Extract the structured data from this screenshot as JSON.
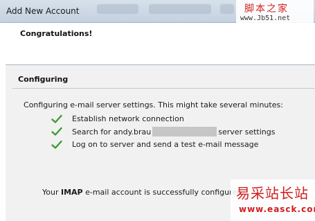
{
  "window": {
    "title": "Add New Account"
  },
  "header": {
    "heading": "Congratulations!"
  },
  "section": {
    "title": "Configuring",
    "lead": "Configuring e-mail server settings. This might take several minutes:",
    "steps": [
      {
        "label": "Establish network connection"
      },
      {
        "label_prefix": "Search for andy.brau",
        "label_suffix": "server settings"
      },
      {
        "label": "Log on to server and send a test e-mail message"
      }
    ]
  },
  "result": {
    "prefix": "Your ",
    "protocol": "IMAP",
    "suffix": " e-mail account is successfully configured."
  },
  "watermarks": {
    "top_text": "脚本之家",
    "top_url": "www.Jb51.net",
    "bottom_text": "易采站长站",
    "bottom_url": "www.easck.com"
  },
  "colors": {
    "check": "#3f9a36",
    "watermark": "#d01c1c"
  },
  "icons": [
    "checkmark-icon"
  ]
}
